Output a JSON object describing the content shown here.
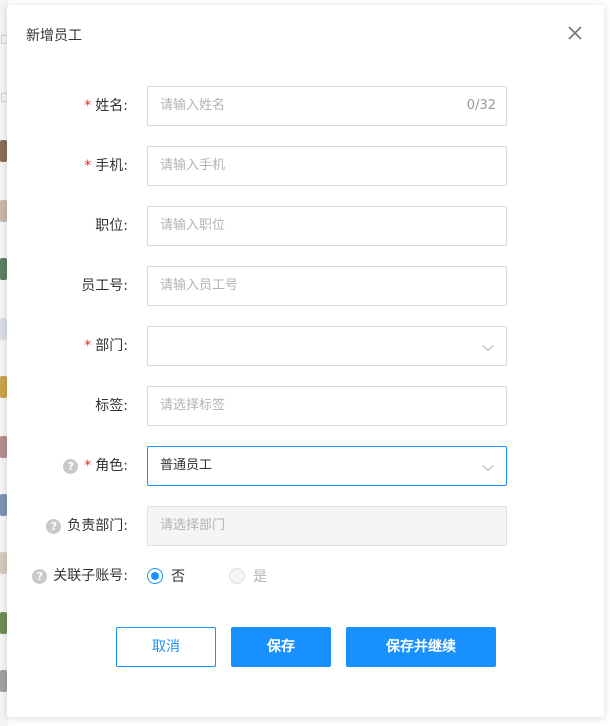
{
  "dialog": {
    "title": "新增员工",
    "close_icon": "close-icon"
  },
  "form": {
    "name": {
      "label": "姓名:",
      "required": true,
      "placeholder": "请输入姓名",
      "counter": "0/32"
    },
    "phone": {
      "label": "手机:",
      "required": true,
      "placeholder": "请输入手机"
    },
    "position": {
      "label": "职位:",
      "required": false,
      "placeholder": "请输入职位"
    },
    "employee_no": {
      "label": "员工号:",
      "required": false,
      "placeholder": "请输入员工号"
    },
    "department": {
      "label": "部门:",
      "required": true,
      "value": "",
      "icon": "chevron-down-icon"
    },
    "tags": {
      "label": "标签:",
      "required": false,
      "placeholder": "请选择标签"
    },
    "role": {
      "label": "角色:",
      "required": true,
      "has_help": true,
      "value": "普通员工",
      "icon": "chevron-down-icon"
    },
    "managed_department": {
      "label": "负责部门:",
      "required": false,
      "has_help": true,
      "placeholder": "请选择部门",
      "disabled": true
    },
    "link_sub_account": {
      "label": "关联子账号:",
      "has_help": true,
      "options": [
        {
          "label": "否",
          "checked": true,
          "disabled": false
        },
        {
          "label": "是",
          "checked": false,
          "disabled": true
        }
      ]
    },
    "required_mark": "*",
    "help_glyph": "?"
  },
  "buttons": {
    "cancel": "取消",
    "save": "保存",
    "save_continue": "保存并继续"
  },
  "colors": {
    "primary": "#1890ff",
    "required": "#f5222d",
    "placeholder": "#b3b3b3",
    "border": "#d9d9d9"
  }
}
